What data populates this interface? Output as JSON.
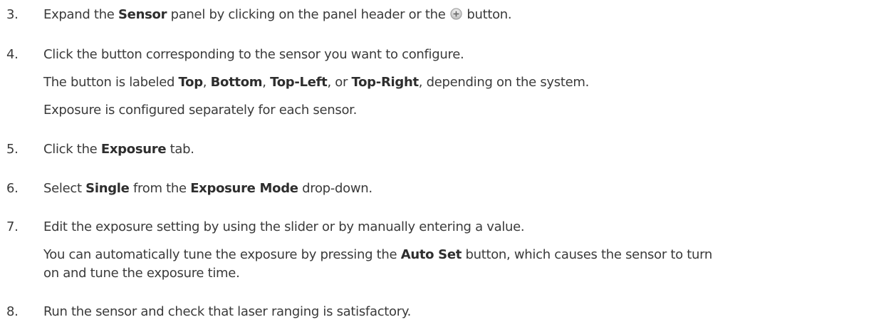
{
  "steps": [
    {
      "number": "3.",
      "parts": [
        "Expand the ",
        "Sensor",
        " panel by clicking on the panel header or the ",
        " button."
      ],
      "icon": "plus-circle-icon"
    },
    {
      "number": "4.",
      "parts": [
        "Click the button corresponding to the sensor you want to configure."
      ],
      "sub1": [
        "The button is labeled ",
        "Top",
        ", ",
        "Bottom",
        ", ",
        "Top-Left",
        ", or ",
        "Top-Right",
        ", depending on the system."
      ],
      "sub2": "Exposure is configured separately for each sensor."
    },
    {
      "number": "5.",
      "parts": [
        "Click the ",
        "Exposure",
        " tab."
      ]
    },
    {
      "number": "6.",
      "parts": [
        "Select ",
        "Single",
        " from the ",
        "Exposure Mode",
        " drop-down."
      ]
    },
    {
      "number": "7.",
      "parts": [
        "Edit the exposure setting by using the slider or by manually entering a value."
      ],
      "sub_line1": [
        "You can automatically tune the exposure by pressing the ",
        "Auto Set",
        " button, which causes the sensor to turn"
      ],
      "sub_line2": "on and tune the exposure time."
    },
    {
      "number": "8.",
      "parts": [
        "Run the sensor and check that laser ranging is satisfactory."
      ]
    }
  ]
}
